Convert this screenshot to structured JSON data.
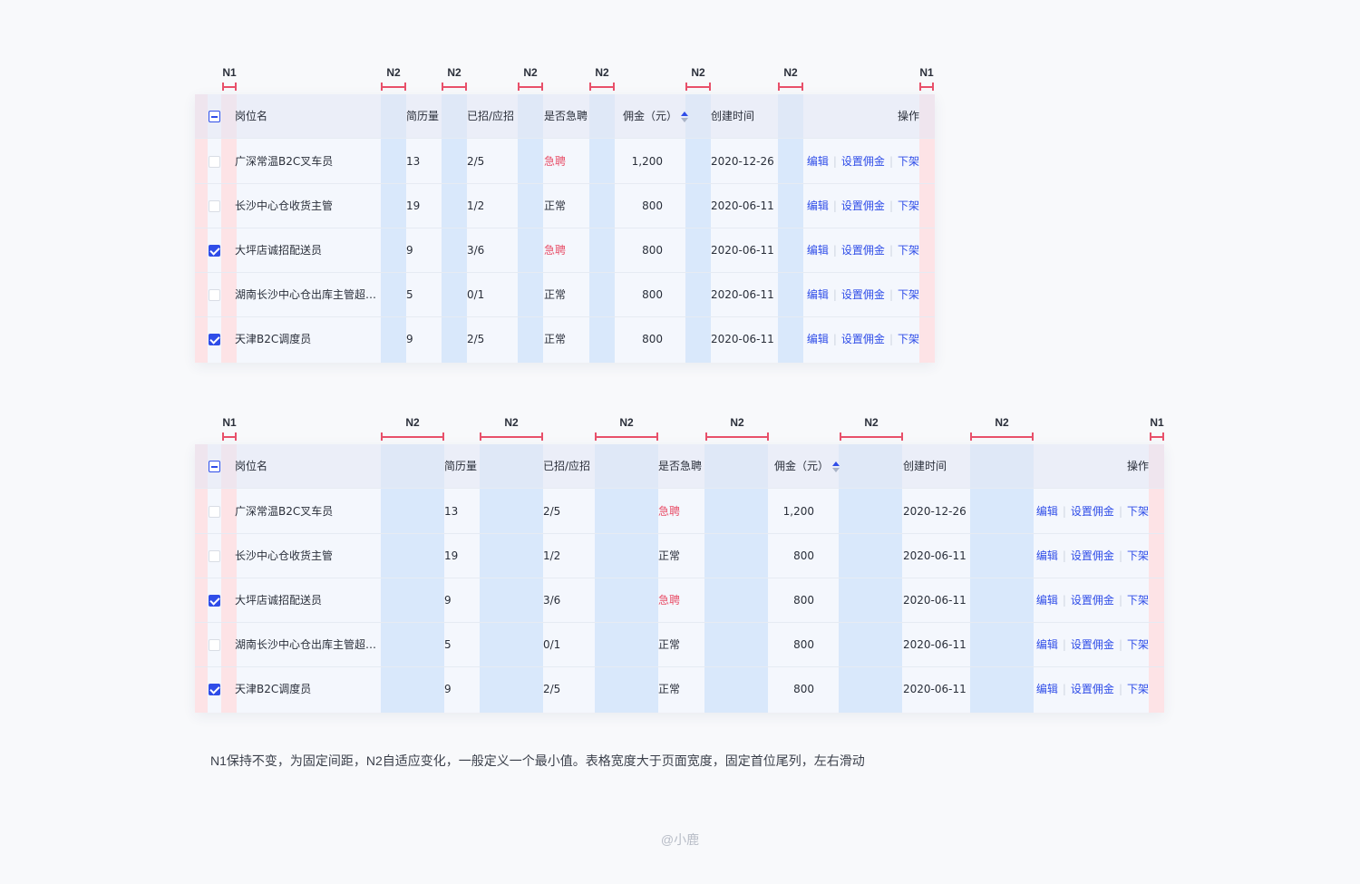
{
  "tables": [
    {
      "markers": [
        "N1",
        "N2",
        "N2",
        "N2",
        "N2",
        "N2",
        "N2",
        "N1"
      ],
      "headers": [
        "岗位名",
        "简历量",
        "已招/应招",
        "是否急聘",
        "佣金（元）",
        "创建时间",
        "操作"
      ],
      "header_checkbox": "indeterminate",
      "rows": [
        {
          "checked": false,
          "name": "广深常温B2C叉车员",
          "resumes": "13",
          "hired": "2/5",
          "urgent": "急聘",
          "is_urgent": true,
          "commission": "1,200",
          "created": "2020-12-26"
        },
        {
          "checked": false,
          "name": "长沙中心仓收货主管",
          "resumes": "19",
          "hired": "1/2",
          "urgent": "正常",
          "is_urgent": false,
          "commission": "800",
          "created": "2020-06-11"
        },
        {
          "checked": true,
          "name": "大坪店诚招配送员",
          "resumes": "9",
          "hired": "3/6",
          "urgent": "急聘",
          "is_urgent": true,
          "commission": "800",
          "created": "2020-06-11"
        },
        {
          "checked": false,
          "name": "湖南长沙中心仓出库主管超…",
          "resumes": "5",
          "hired": "0/1",
          "urgent": "正常",
          "is_urgent": false,
          "commission": "800",
          "created": "2020-06-11"
        },
        {
          "checked": true,
          "name": "天津B2C调度员",
          "resumes": "9",
          "hired": "2/5",
          "urgent": "正常",
          "is_urgent": false,
          "commission": "800",
          "created": "2020-06-11"
        }
      ],
      "actions": [
        "编辑",
        "设置佣金",
        "下架"
      ]
    },
    {
      "markers": [
        "N1",
        "N2",
        "N2",
        "N2",
        "N2",
        "N2",
        "N2",
        "N1"
      ],
      "headers": [
        "岗位名",
        "简历量",
        "已招/应招",
        "是否急聘",
        "佣金（元）",
        "创建时间",
        "操作"
      ],
      "header_checkbox": "indeterminate",
      "rows": [
        {
          "checked": false,
          "name": "广深常温B2C叉车员",
          "resumes": "13",
          "hired": "2/5",
          "urgent": "急聘",
          "is_urgent": true,
          "commission": "1,200",
          "created": "2020-12-26"
        },
        {
          "checked": false,
          "name": "长沙中心仓收货主管",
          "resumes": "19",
          "hired": "1/2",
          "urgent": "正常",
          "is_urgent": false,
          "commission": "800",
          "created": "2020-06-11"
        },
        {
          "checked": true,
          "name": "大坪店诚招配送员",
          "resumes": "9",
          "hired": "3/6",
          "urgent": "急聘",
          "is_urgent": true,
          "commission": "800",
          "created": "2020-06-11"
        },
        {
          "checked": false,
          "name": "湖南长沙中心仓出库主管超…",
          "resumes": "5",
          "hired": "0/1",
          "urgent": "正常",
          "is_urgent": false,
          "commission": "800",
          "created": "2020-06-11"
        },
        {
          "checked": true,
          "name": "天津B2C调度员",
          "resumes": "9",
          "hired": "2/5",
          "urgent": "正常",
          "is_urgent": false,
          "commission": "800",
          "created": "2020-06-11"
        }
      ],
      "actions": [
        "编辑",
        "设置佣金",
        "下架"
      ]
    }
  ],
  "caption": "N1保持不变，为固定间距，N2自适应变化，一般定义一个最小值。表格宽度大于页面宽度，固定首位尾列，左右滑动",
  "credit": "@小鹿",
  "colors": {
    "accent": "#2f4de8",
    "urgent": "#e8506a",
    "n1_shade": "#fde3e6",
    "n2_shade": "#d9e8fb",
    "marker": "#e8506a"
  }
}
